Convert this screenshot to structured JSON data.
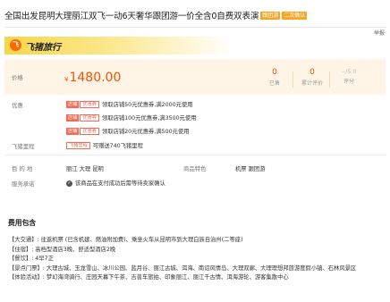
{
  "product": {
    "title": "全国出发昆明大理丽江双飞一动6天奢华跟团游一价全含0自费双表演",
    "tags": [
      "跟团游",
      "二次确认"
    ],
    "reporter": "举报"
  },
  "brand": {
    "logo_glyph": "飞",
    "name": "飞猪旅行"
  },
  "price_box": {
    "label": "价格",
    "currency": "¥",
    "price": "1480.00",
    "stats": [
      {
        "value": "0",
        "label": "已售"
      },
      {
        "value": "0",
        "label": "累计评价"
      },
      {
        "value": "--/5.0",
        "label": "评分"
      }
    ]
  },
  "promotions": {
    "label": "优惠",
    "items": [
      {
        "tags": [
          "店铺",
          "优惠券"
        ],
        "text": "领取店铺50元优惠券,满2000元使用"
      },
      {
        "tags": [
          "店铺",
          "优惠券"
        ],
        "text": "领取店铺100元优惠券,满3500元使用"
      },
      {
        "tags": [
          "店铺",
          "优惠券"
        ],
        "text": "领取店铺20元优惠券,满500元使用"
      }
    ]
  },
  "mileage": {
    "label": "飞猪里程",
    "tag": "飞猪里程",
    "text": "可赠送740飞猪里程"
  },
  "info": {
    "destination_label": "目 的 地",
    "destinations": "丽江  大理  昆明",
    "feature_label": "商品特色",
    "features": "机票  跟团游",
    "service_label": "服务承诺",
    "service_text": "该商品在支付成功后需等待卖家确认"
  },
  "fee": {
    "heading": "费用包含",
    "lines": [
      "【大交通】: 往返机票 (已含机建、燃油附加费)、乘坐火车从昆明市到大理白族自治州(二等座)",
      "【住宿】: 高档型酒店3晚、舒适型酒店2晚",
      "【餐饮】: 4早7正",
      "【景点门票】: 大理古城、玉龙雪山、冰川公园、蓝月谷、丽江古城、洱海、南诏风情岛、大理双廊、大理理想邦旅游度假小镇、石林风景区",
      "【体验活动】: 梦幻海湾骑行、庄园天幕下午茶、吉普车旅拍、印象丽江、丽江千古情、洱海游轮、游客集散中心"
    ]
  }
}
